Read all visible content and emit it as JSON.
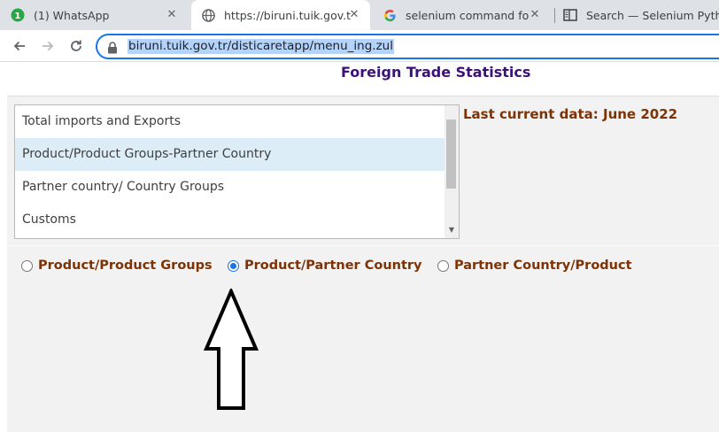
{
  "browser": {
    "tabs": [
      {
        "title": "(1) WhatsApp",
        "favicon": "whatsapp-badge-icon",
        "badge": "1",
        "active": false
      },
      {
        "title": "https://biruni.tuik.gov.tr/disticaretapp/menu_ing.zul",
        "favicon": "globe-icon",
        "active": true
      },
      {
        "title": "selenium command for list",
        "favicon": "google-icon",
        "active": false
      },
      {
        "title": "Search — Selenium Python",
        "favicon": "reader-icon",
        "active": false
      }
    ],
    "close_glyph": "✕",
    "address": {
      "url": "biruni.tuik.gov.tr/disticaretapp/menu_ing.zul",
      "selected": true
    },
    "accent_color": "#1a73e8"
  },
  "page": {
    "title": "Foreign Trade Statistics",
    "last_data": "Last current data: June 2022",
    "listbox": {
      "options": [
        "Total imports and Exports",
        "Product/Product Groups-Partner Country",
        "Partner country/ Country Groups",
        "Customs"
      ],
      "selected_index": 1
    },
    "radios": [
      {
        "label": "Product/Product Groups",
        "checked": false
      },
      {
        "label": "Product/Partner Country",
        "checked": true
      },
      {
        "label": "Partner Country/Product",
        "checked": false
      }
    ],
    "colors": {
      "title": "#3b1277",
      "label": "#7c3306",
      "selected_row": "#dcedf7"
    }
  }
}
